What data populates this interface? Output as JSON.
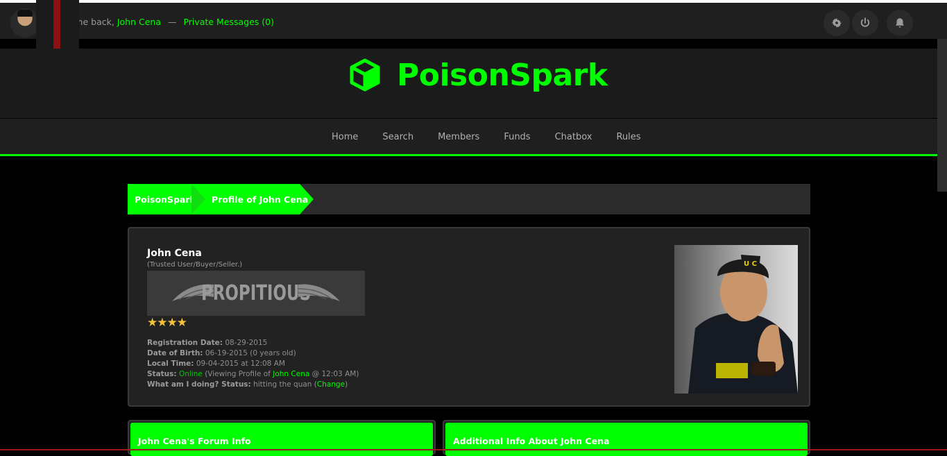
{
  "topbar": {
    "welcome_prefix": "Welcome back,",
    "username": "John Cena",
    "separator": "—",
    "private_messages": "Private Messages (0)",
    "icons": [
      "gear-icon",
      "power-icon",
      "bell-icon"
    ]
  },
  "site": {
    "name": "PoisonSpark",
    "accent_color": "#00ff00"
  },
  "nav": {
    "items": [
      "Home",
      "Search",
      "Members",
      "Funds",
      "Chatbox",
      "Rules"
    ]
  },
  "breadcrumb": {
    "root": "PoisonSpark",
    "current": "Profile of John Cena"
  },
  "profile": {
    "name": "John Cena",
    "usertitle": "(Trusted User/Buyer/Seller.)",
    "banner_text": "PROPITIOUS",
    "stars": "★★★★",
    "star_count": 4,
    "registration_label": "Registration Date:",
    "registration_value": "08-29-2015",
    "dob_label": "Date of Birth:",
    "dob_value": "06-19-2015 (0 years old)",
    "localtime_label": "Local Time:",
    "localtime_value": "09-04-2015 at 12:08 AM",
    "status_label": "Status:",
    "status_value": "Online",
    "status_detail_prefix": "(Viewing Profile of",
    "status_detail_user": "John Cena",
    "status_detail_suffix": "@ 12:03 AM)",
    "doing_label": "What am I doing? Status:",
    "doing_value": "hitting the quan",
    "change_prefix": "(",
    "change_link": "Change",
    "change_suffix": ")"
  },
  "boxes": {
    "forum_info": "John Cena's Forum Info",
    "additional_info": "Additional Info About John Cena"
  }
}
